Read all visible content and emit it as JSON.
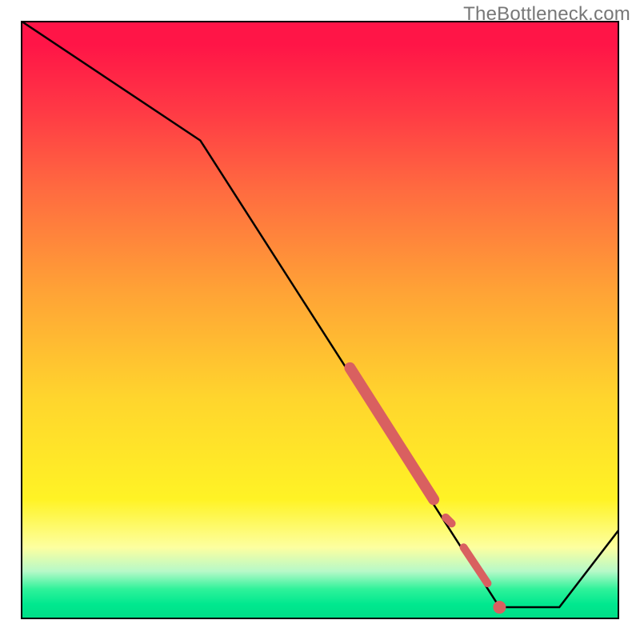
{
  "watermark": "TheBottleneck.com",
  "chart_data": {
    "type": "line",
    "title": "",
    "xlabel": "",
    "ylabel": "",
    "x_range": [
      0,
      100
    ],
    "y_range": [
      0,
      100
    ],
    "series": [
      {
        "name": "main-curve",
        "x": [
          0,
          30,
          80,
          90,
          100
        ],
        "y": [
          100,
          80,
          2,
          2,
          15
        ]
      }
    ],
    "highlight_segments": [
      {
        "name": "thick-upper",
        "x": [
          55,
          69
        ],
        "y": [
          42,
          20
        ],
        "width": 14
      },
      {
        "name": "thick-mid",
        "x": [
          71,
          72
        ],
        "y": [
          17,
          16
        ],
        "width": 10
      },
      {
        "name": "thick-lower",
        "x": [
          74,
          78
        ],
        "y": [
          12,
          6
        ],
        "width": 10
      }
    ],
    "highlight_point": {
      "x": 80,
      "y": 2,
      "r": 8
    },
    "colors": {
      "curve": "#000000",
      "highlight": "#d96060",
      "gradient_top": "#ff1547",
      "gradient_mid": "#ffd52d",
      "gradient_bottom": "#00de86"
    }
  }
}
